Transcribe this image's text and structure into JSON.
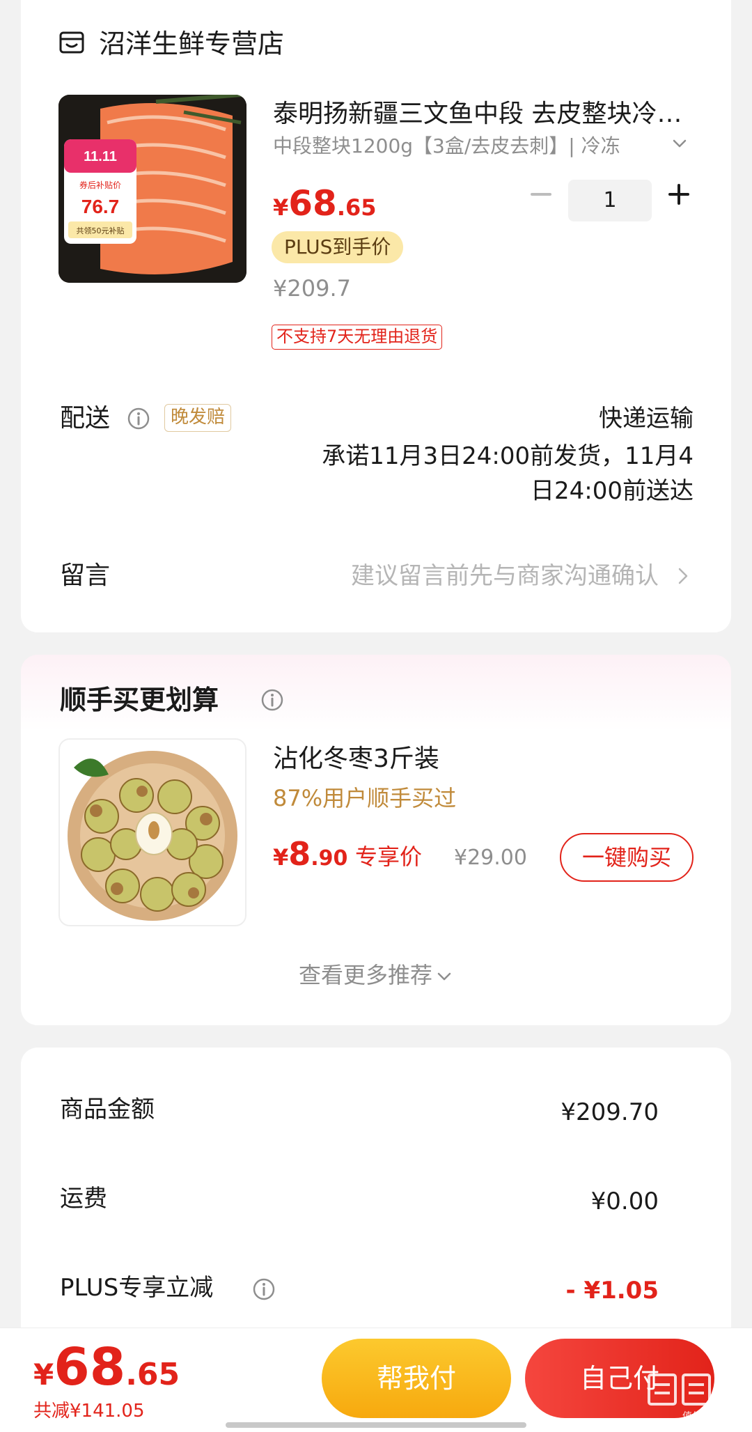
{
  "store": {
    "name": "沼洋生鲜专营店",
    "icon": "store-icon"
  },
  "product": {
    "title": "泰明扬新疆三文鱼中段 去皮整块冷冻三文鱼",
    "spec": "中段整块1200g【3盒/去皮去刺】| 冷冻",
    "price": {
      "currency": "¥",
      "integer": "68",
      "decimal": ".65"
    },
    "plus_tag": "PLUS到手价",
    "original_price": "¥209.7",
    "return_policy": "不支持7天无理由退货",
    "quantity": "1",
    "image_badges": {
      "event": "11.11",
      "subsidy_label": "券后补贴价",
      "subsidy_price": "76.7",
      "coupon_text": "共领50元补贴"
    }
  },
  "delivery": {
    "label": "配送",
    "late_tag": "晚发赔",
    "method": "快递运输",
    "promise_line1": "承诺11月3日24:00前发货，11月4",
    "promise_line2": "日24:00前送达"
  },
  "message": {
    "label": "留言",
    "placeholder": "建议留言前先与商家沟通确认"
  },
  "recommend": {
    "title": "顺手买更划算",
    "item": {
      "name": "沾化冬枣3斤装",
      "subtitle": "87%用户顺手买过",
      "price": {
        "currency": "¥",
        "integer": "8",
        "decimal": ".90"
      },
      "exclusive_label": "专享价",
      "original_price": "¥29.00",
      "buy_label": "一键购买"
    },
    "more_label": "查看更多推荐"
  },
  "summary": [
    {
      "label": "商品金额",
      "value": "¥209.70"
    },
    {
      "label": "运费",
      "value": "¥0.00"
    },
    {
      "label": "PLUS专享立减",
      "value": "- ¥1.05"
    }
  ],
  "bottom": {
    "total": {
      "currency": "¥",
      "integer": "68",
      "decimal": ".65"
    },
    "saved": "共减¥141.05",
    "help_pay": "帮我付",
    "self_pay": "自己付",
    "watermark": "值值值"
  },
  "colors": {
    "accent": "#e2231a",
    "gold": "#c08a3a",
    "plus_tag_bg": "#fbe8a8",
    "help_button": "#f7a90e"
  }
}
